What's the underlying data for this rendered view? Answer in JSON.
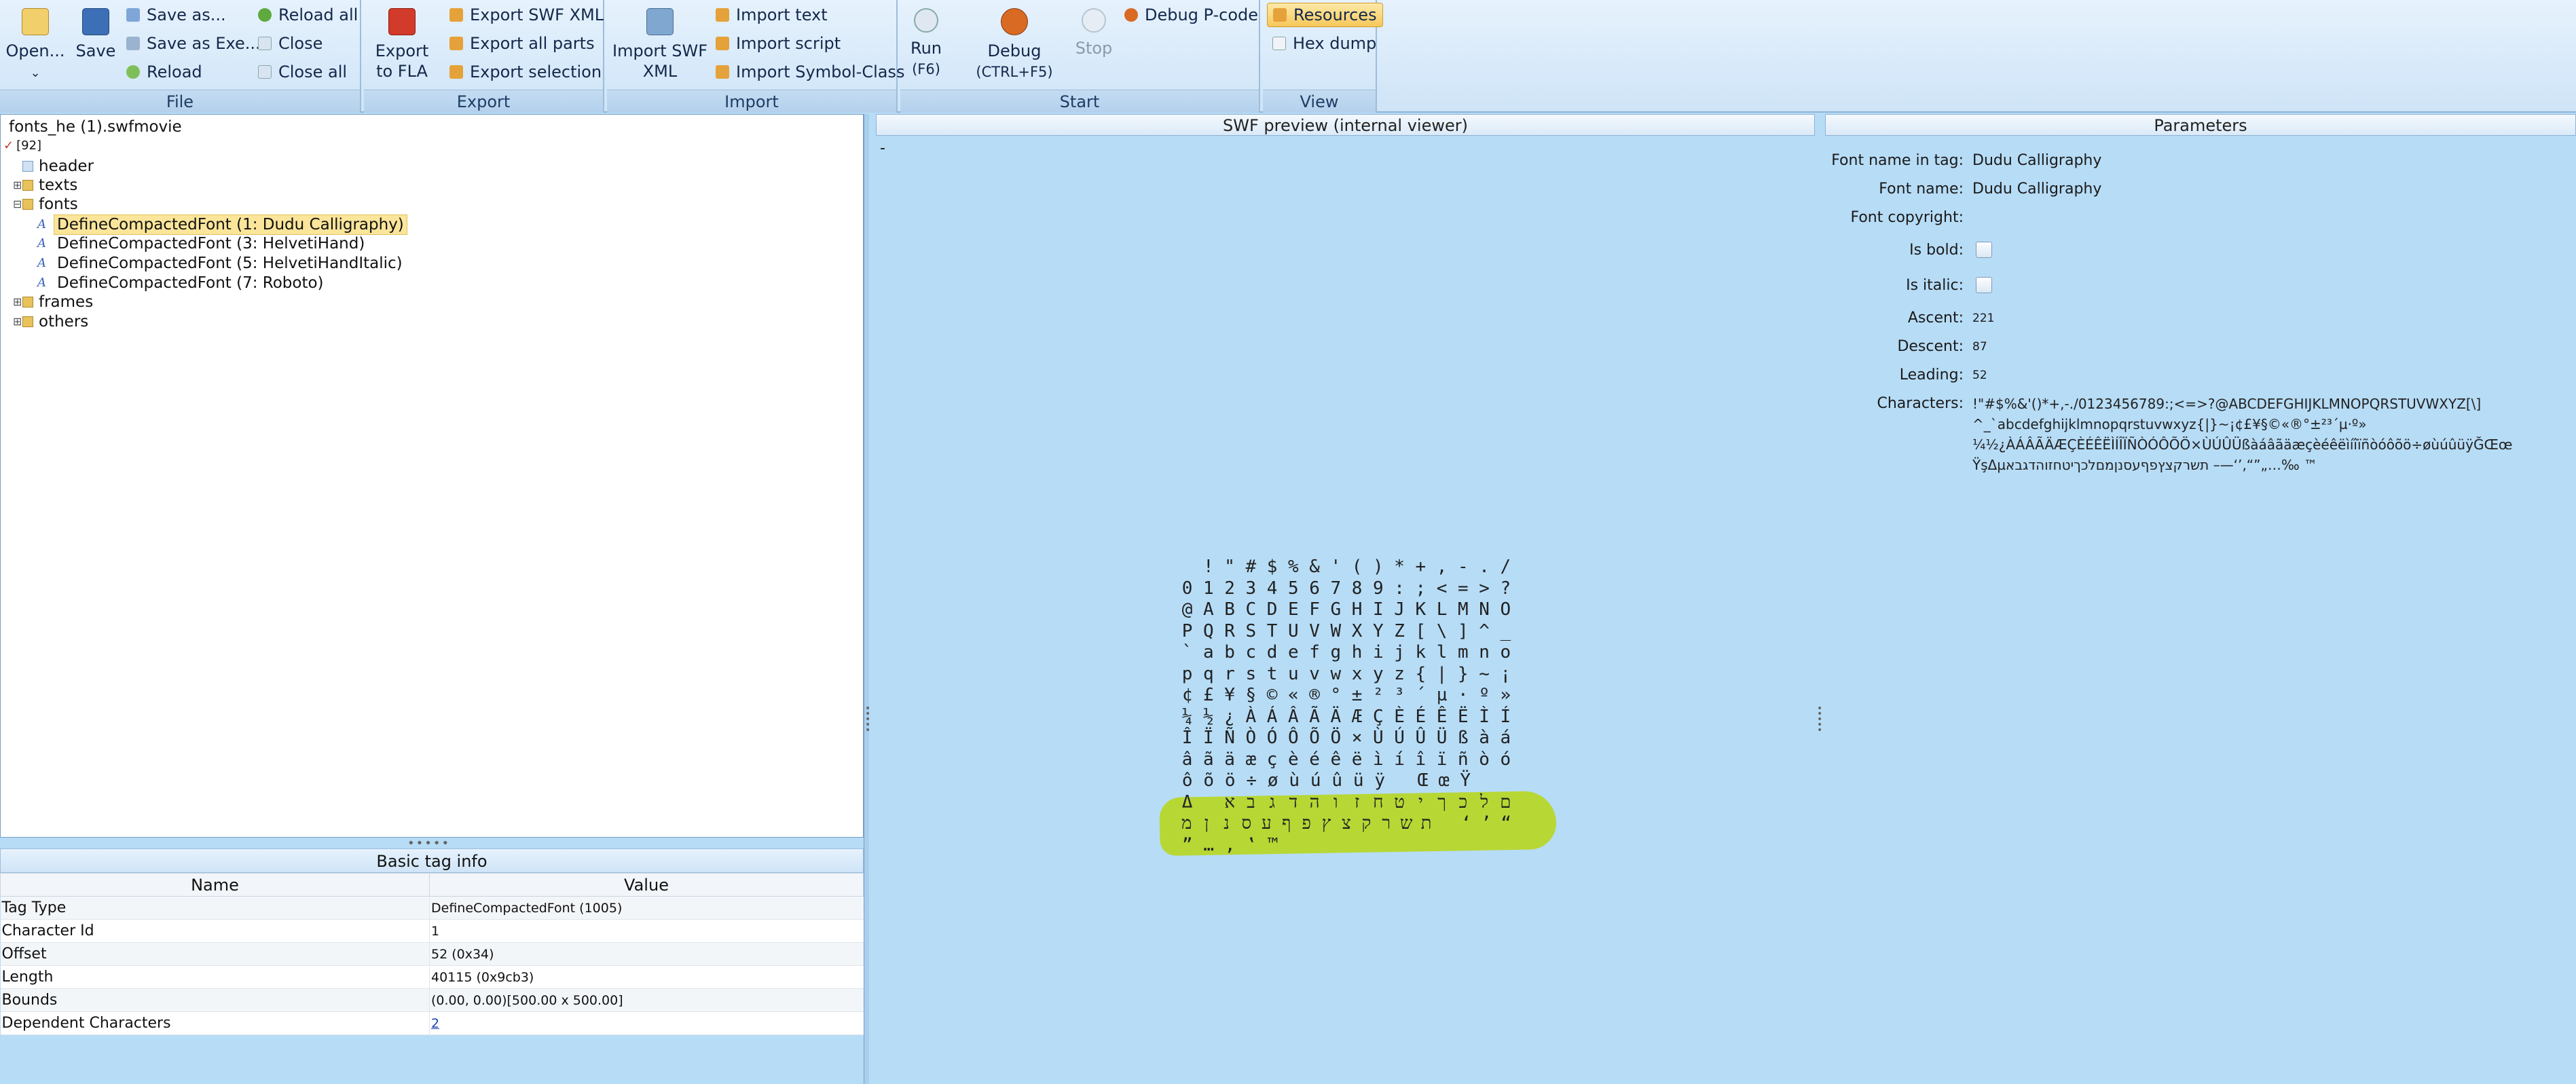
{
  "ribbon": {
    "file": {
      "label": "File",
      "open": "Open...",
      "save": "Save",
      "save_as": "Save as...",
      "save_as_exe": "Save as Exe...",
      "reload": "Reload",
      "reload_all": "Reload all",
      "close": "Close",
      "close_all": "Close all"
    },
    "export": {
      "label": "Export",
      "export_fla_1": "Export",
      "export_fla_2": "to FLA",
      "export_swf_xml": "Export SWF XML",
      "export_all_parts": "Export all parts",
      "export_selection": "Export selection"
    },
    "import": {
      "label": "Import",
      "import_swf_xml_1": "Import SWF",
      "import_swf_xml_2": "XML",
      "import_text": "Import text",
      "import_script": "Import script",
      "import_symbol_class": "Import Symbol-Class"
    },
    "start": {
      "label": "Start",
      "run_1": "Run",
      "run_2": "(F6)",
      "debug_1": "Debug",
      "debug_2": "(CTRL+F5)",
      "stop": "Stop",
      "debug_pcode": "Debug P-code"
    },
    "view": {
      "label": "View",
      "resources": "Resources",
      "hex_dump": "Hex dump"
    }
  },
  "tree": {
    "root": "fonts_he (1).swfmovie",
    "count": "[92]",
    "header": "header",
    "texts": "texts",
    "fonts": "fonts",
    "font_items": [
      "DefineCompactedFont (1: Dudu Calligraphy)",
      "DefineCompactedFont (3: HelvetiHand)",
      "DefineCompactedFont (5: HelvetiHandItalic)",
      "DefineCompactedFont (7: Roboto)"
    ],
    "frames": "frames",
    "others": "others"
  },
  "taginfo": {
    "title": "Basic tag info",
    "col_name": "Name",
    "col_value": "Value",
    "rows": [
      {
        "name": "Tag Type",
        "value": "DefineCompactedFont (1005)"
      },
      {
        "name": "Character Id",
        "value": "1"
      },
      {
        "name": "Offset",
        "value": "52 (0x34)"
      },
      {
        "name": "Length",
        "value": "40115 (0x9cb3)"
      },
      {
        "name": "Bounds",
        "value": "(0.00, 0.00)[500.00 x 500.00]"
      },
      {
        "name": "Dependent Characters",
        "value": "2"
      }
    ]
  },
  "preview": {
    "title": "SWF preview (internal viewer)",
    "dash": "-",
    "glyph_rows": [
      " !\"#$%&'()*+,-./",
      "0123456789:;<=>?",
      "@ABCDEFGHIJKLMNO",
      "PQRSTUVWXYZ[\\]^_",
      "`abcdefghijklmno",
      "pqrstuvwxyz{|}~¡",
      "¢£¥§©«®°±²³´µ·º»",
      "¼½¿ÀÁÂÃÄÆÇÈÉÊËÌÍ",
      "ÎÏÑÒÓÔÕÖ×ÙÚÛÜßàá",
      "âãäæçèéêëìíîïñòó",
      "ôõö÷øùúûüÿ ŒœŸ ",
      "Δ אבגדהוזחטיךכלם",
      "מןנסעףפץצקרשת ‘’“",
      "”…‚‛™ "
    ]
  },
  "params": {
    "title": "Parameters",
    "font_name_in_tag_label": "Font name in tag:",
    "font_name_in_tag": "Dudu Calligraphy",
    "font_name_label": "Font name:",
    "font_name": "Dudu Calligraphy",
    "font_copyright_label": "Font copyright:",
    "is_bold_label": "Is bold:",
    "is_italic_label": "Is italic:",
    "ascent_label": "Ascent:",
    "ascent": "221",
    "descent_label": "Descent:",
    "descent": "87",
    "leading_label": "Leading:",
    "leading": "52",
    "characters_label": "Characters:",
    "characters": [
      "!\"#$%&'()*+,-./0123456789:;<=>?@ABCDEFGHIJKLMNOPQRSTUVWXYZ[\\]",
      "^_`abcdefghijklmnopqrstuvwxyz{|}~¡¢£¥§©«®°±²³´µ·º»",
      "¼½¿ÀÁÂÃÄÆÇÈÉÊËÌÍÎÏÑÒÓÔÕÖ×ÙÚÛÜßàáâãäæçèéêëìíîïñòóôõö÷øùúûüÿĞŒœ",
      "ŸşΔµתשרקצץפףעסנןמםלכךיטחזוהדגבא   –—‘’‚“”„…‰ ™"
    ]
  },
  "colors": {
    "ribbon_bg": "#dbeaf8",
    "panel_bg": "#b7dcf6",
    "selection": "#fbe59a",
    "highlight_scribble": "#b6d62a"
  }
}
